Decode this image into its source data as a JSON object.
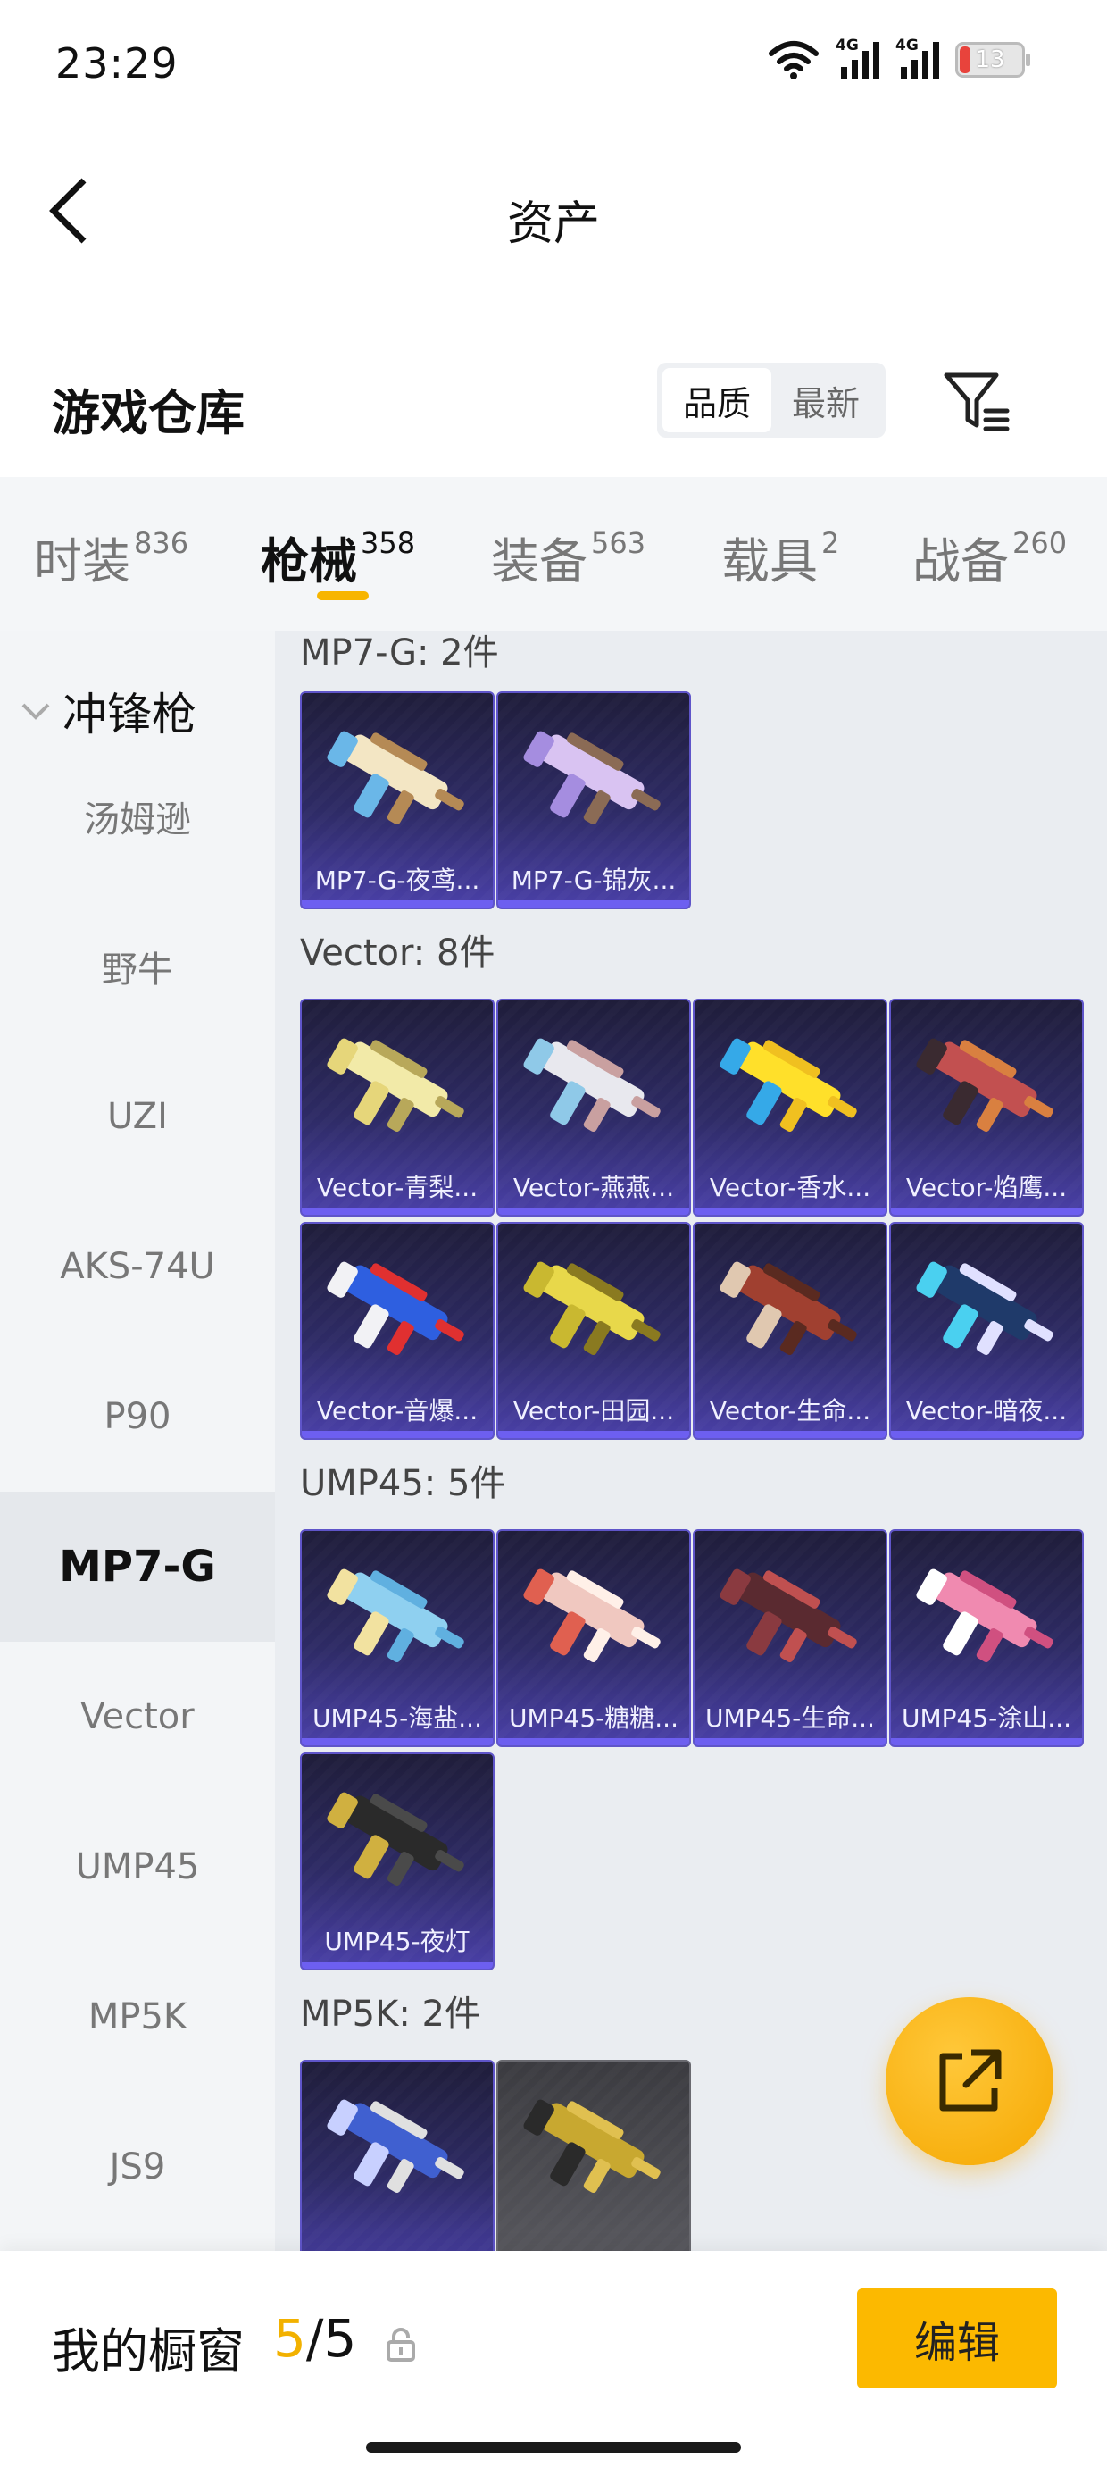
{
  "status_bar": {
    "time": "23:29",
    "network_1": "4G",
    "network_2": "4G",
    "battery": "13",
    "battery_color": "#e8433c"
  },
  "header": {
    "title": "资产",
    "back_icon": "chevron-left-icon"
  },
  "warehouse": {
    "title": "游戏仓库",
    "sort_options": [
      "品质",
      "最新"
    ],
    "sort_selected": "品质",
    "filter_icon": "filter-list-icon"
  },
  "tabs": [
    {
      "label": "时装",
      "count": "836"
    },
    {
      "label": "枪械",
      "count": "358",
      "active": true
    },
    {
      "label": "装备",
      "count": "563"
    },
    {
      "label": "载具",
      "count": "2"
    },
    {
      "label": "战备",
      "count": "260"
    }
  ],
  "sidebar": {
    "group_label": "冲锋枪",
    "items": [
      "汤姆逊",
      "野牛",
      "UZI",
      "AKS-74U",
      "P90",
      "MP7-G",
      "Vector",
      "UMP45",
      "MP5K",
      "JS9"
    ],
    "active_item": "MP7-G"
  },
  "sections": [
    {
      "title": "MP7-G: 2件",
      "items": [
        "MP7-G-夜鸢...",
        "MP7-G-锦灰..."
      ]
    },
    {
      "title": "Vector: 8件",
      "items": [
        "Vector-青梨...",
        "Vector-燕燕...",
        "Vector-香水...",
        "Vector-焰鹰...",
        "Vector-音爆...",
        "Vector-田园...",
        "Vector-生命...",
        "Vector-暗夜..."
      ]
    },
    {
      "title": "UMP45: 5件",
      "items": [
        "UMP45-海盐...",
        "UMP45-糖糖...",
        "UMP45-生命...",
        "UMP45-涂山...",
        "UMP45-夜灯"
      ]
    },
    {
      "title": "MP5K: 2件",
      "items": [
        "",
        ""
      ]
    }
  ],
  "colors": {
    "accent": "#f7b500",
    "card_bg": "#2e2b66",
    "card_border": "#5f55c9"
  },
  "fab": {
    "icon": "share-external-icon"
  },
  "bottom_bar": {
    "showcase_label": "我的橱窗",
    "showcase_used": "5",
    "showcase_sep": "/",
    "showcase_total": "5",
    "lock_icon": "lock-icon",
    "edit_label": "编辑"
  }
}
